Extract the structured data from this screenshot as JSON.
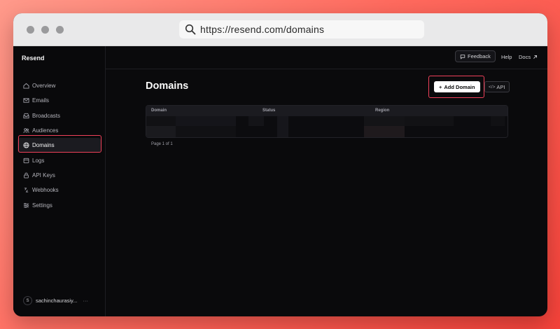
{
  "browser": {
    "url": "https://resend.com/domains"
  },
  "sidebar": {
    "brand": "Resend",
    "items": [
      {
        "label": "Overview",
        "icon": "home-icon"
      },
      {
        "label": "Emails",
        "icon": "mail-icon"
      },
      {
        "label": "Broadcasts",
        "icon": "inbox-icon"
      },
      {
        "label": "Audiences",
        "icon": "users-icon"
      },
      {
        "label": "Domains",
        "icon": "globe-icon",
        "active": true
      },
      {
        "label": "Logs",
        "icon": "list-icon"
      },
      {
        "label": "API Keys",
        "icon": "lock-icon"
      },
      {
        "label": "Webhooks",
        "icon": "webhook-icon"
      },
      {
        "label": "Settings",
        "icon": "sliders-icon"
      }
    ],
    "user": {
      "initial": "S",
      "name": "sachinchaurasiy...",
      "more": "···"
    }
  },
  "topbar": {
    "feedback": "Feedback",
    "help": "Help",
    "docs": "Docs"
  },
  "main": {
    "title": "Domains",
    "add_button": "Add Domain",
    "api_button": "API",
    "table": {
      "columns": [
        "Domain",
        "Status",
        "Region"
      ]
    },
    "pagination": "Page 1 of 1"
  },
  "colors": {
    "highlight": "#f0415a",
    "background": "#0a0a0c"
  }
}
